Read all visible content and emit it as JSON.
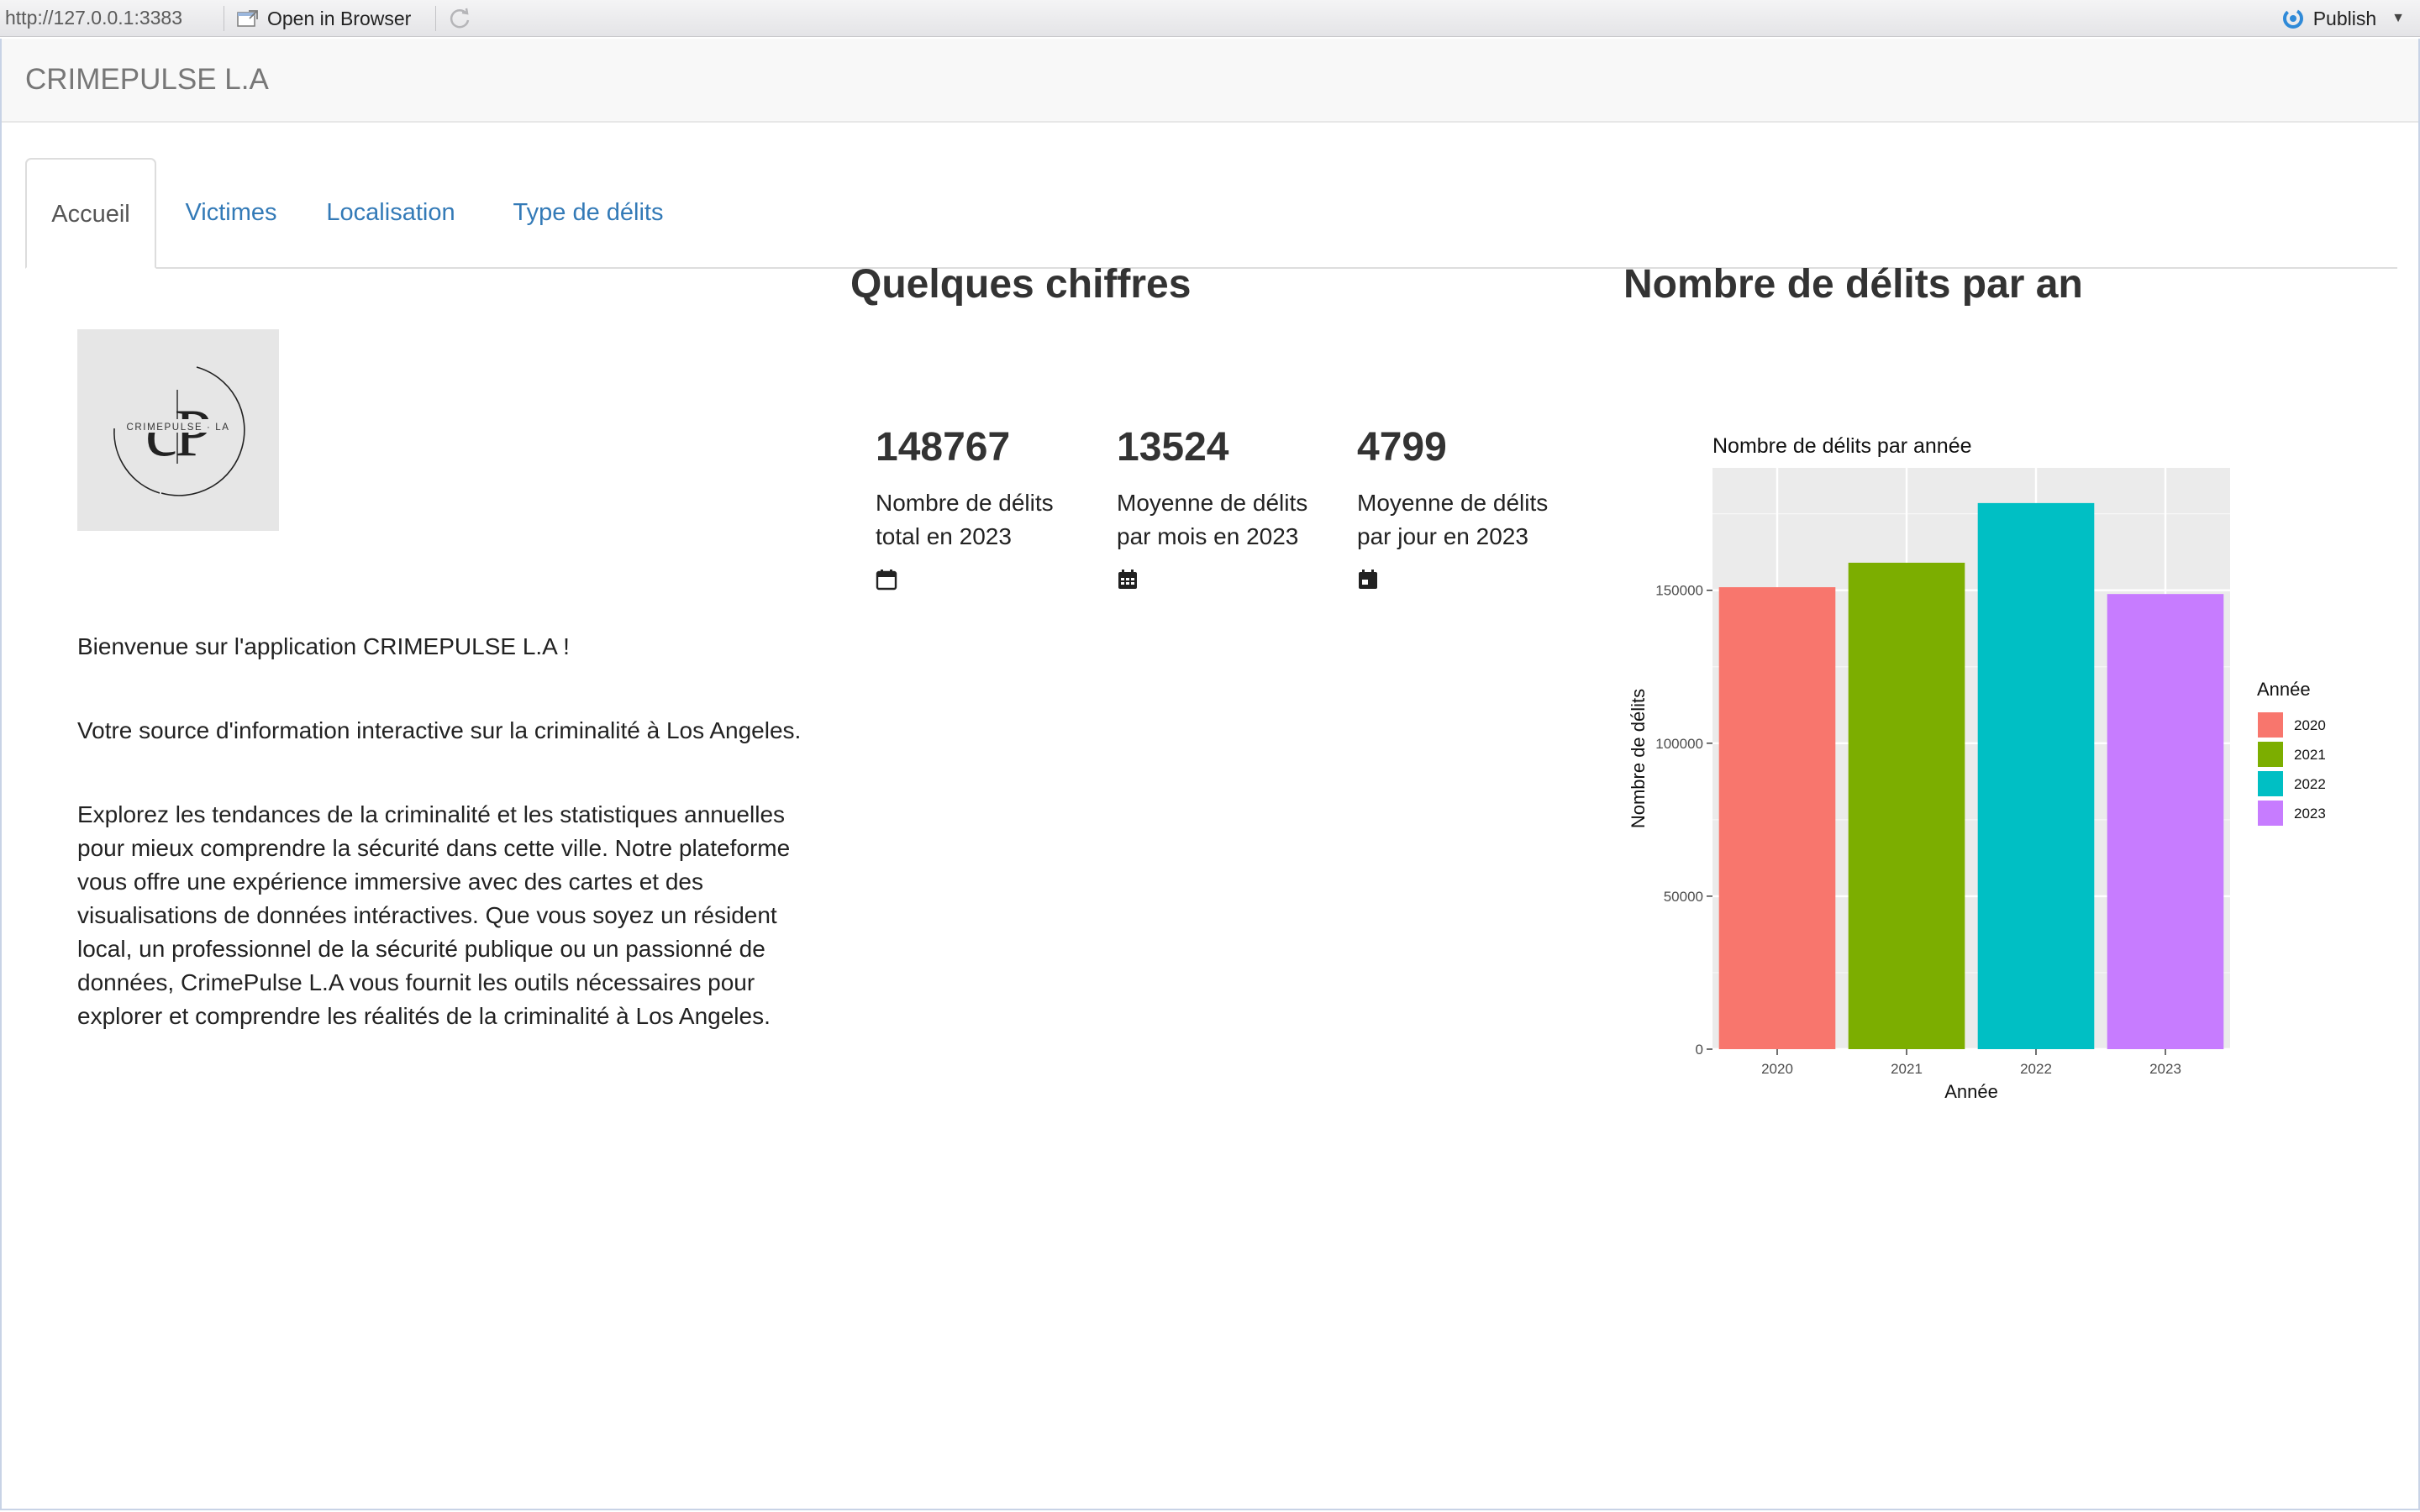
{
  "toolbar": {
    "url": "http://127.0.0.1:3383",
    "open_in_browser": "Open in Browser",
    "publish": "Publish",
    "open_icon": "open-window-icon",
    "refresh_icon": "refresh-icon",
    "publish_icon": "publish-icon"
  },
  "app": {
    "brand": "CRIMEPULSE L.A"
  },
  "tabs": [
    {
      "label": "Accueil",
      "active": true
    },
    {
      "label": "Victimes",
      "active": false
    },
    {
      "label": "Localisation",
      "active": false
    },
    {
      "label": "Type de délits",
      "active": false
    }
  ],
  "home": {
    "logo_text": "CRIMEPULSE · LA",
    "logo_letters": "cP",
    "welcome": "Bienvenue sur l'application CRIMEPULSE L.A !",
    "para1": "Votre source d'information interactive sur la criminalité à Los Angeles.",
    "para2": "Explorez les tendances de la criminalité et les statistiques annuelles pour mieux comprendre la sécurité dans cette ville. Notre plateforme vous offre une expérience immersive avec des cartes et des visualisations de données intéractives. Que vous soyez un résident local, un professionnel de la sécurité publique ou un passionné de données, CrimePulse L.A vous fournit les outils nécessaires pour explorer et comprendre les réalités de la criminalité à Los Angeles."
  },
  "stats": {
    "heading": "Quelques chiffres",
    "items": [
      {
        "value": "148767",
        "label": "Nombre de délits total en 2023",
        "icon": "calendar-icon"
      },
      {
        "value": "13524",
        "label": "Moyenne de délits par mois en 2023",
        "icon": "calendar-days-icon"
      },
      {
        "value": "4799",
        "label": "Moyenne de délits par jour en 2023",
        "icon": "calendar-day-icon"
      }
    ]
  },
  "chart_section": {
    "heading": "Nombre de délits par an"
  },
  "chart_data": {
    "type": "bar",
    "title": "Nombre de délits par année",
    "xlabel": "Année",
    "ylabel": "Nombre de délits",
    "categories": [
      "2020",
      "2021",
      "2022",
      "2023"
    ],
    "values": [
      151000,
      159000,
      178500,
      148767
    ],
    "ylim": [
      0,
      190000
    ],
    "yticks": [
      0,
      50000,
      100000,
      150000
    ],
    "ytick_labels": [
      "0",
      "50000",
      "100000",
      "150000"
    ],
    "colors": [
      "#F8766D",
      "#7CAE00",
      "#00BFC4",
      "#C77CFF"
    ],
    "legend_title": "Année",
    "legend_position": "right",
    "grid": true,
    "panel_background": "#EBEBEB"
  }
}
